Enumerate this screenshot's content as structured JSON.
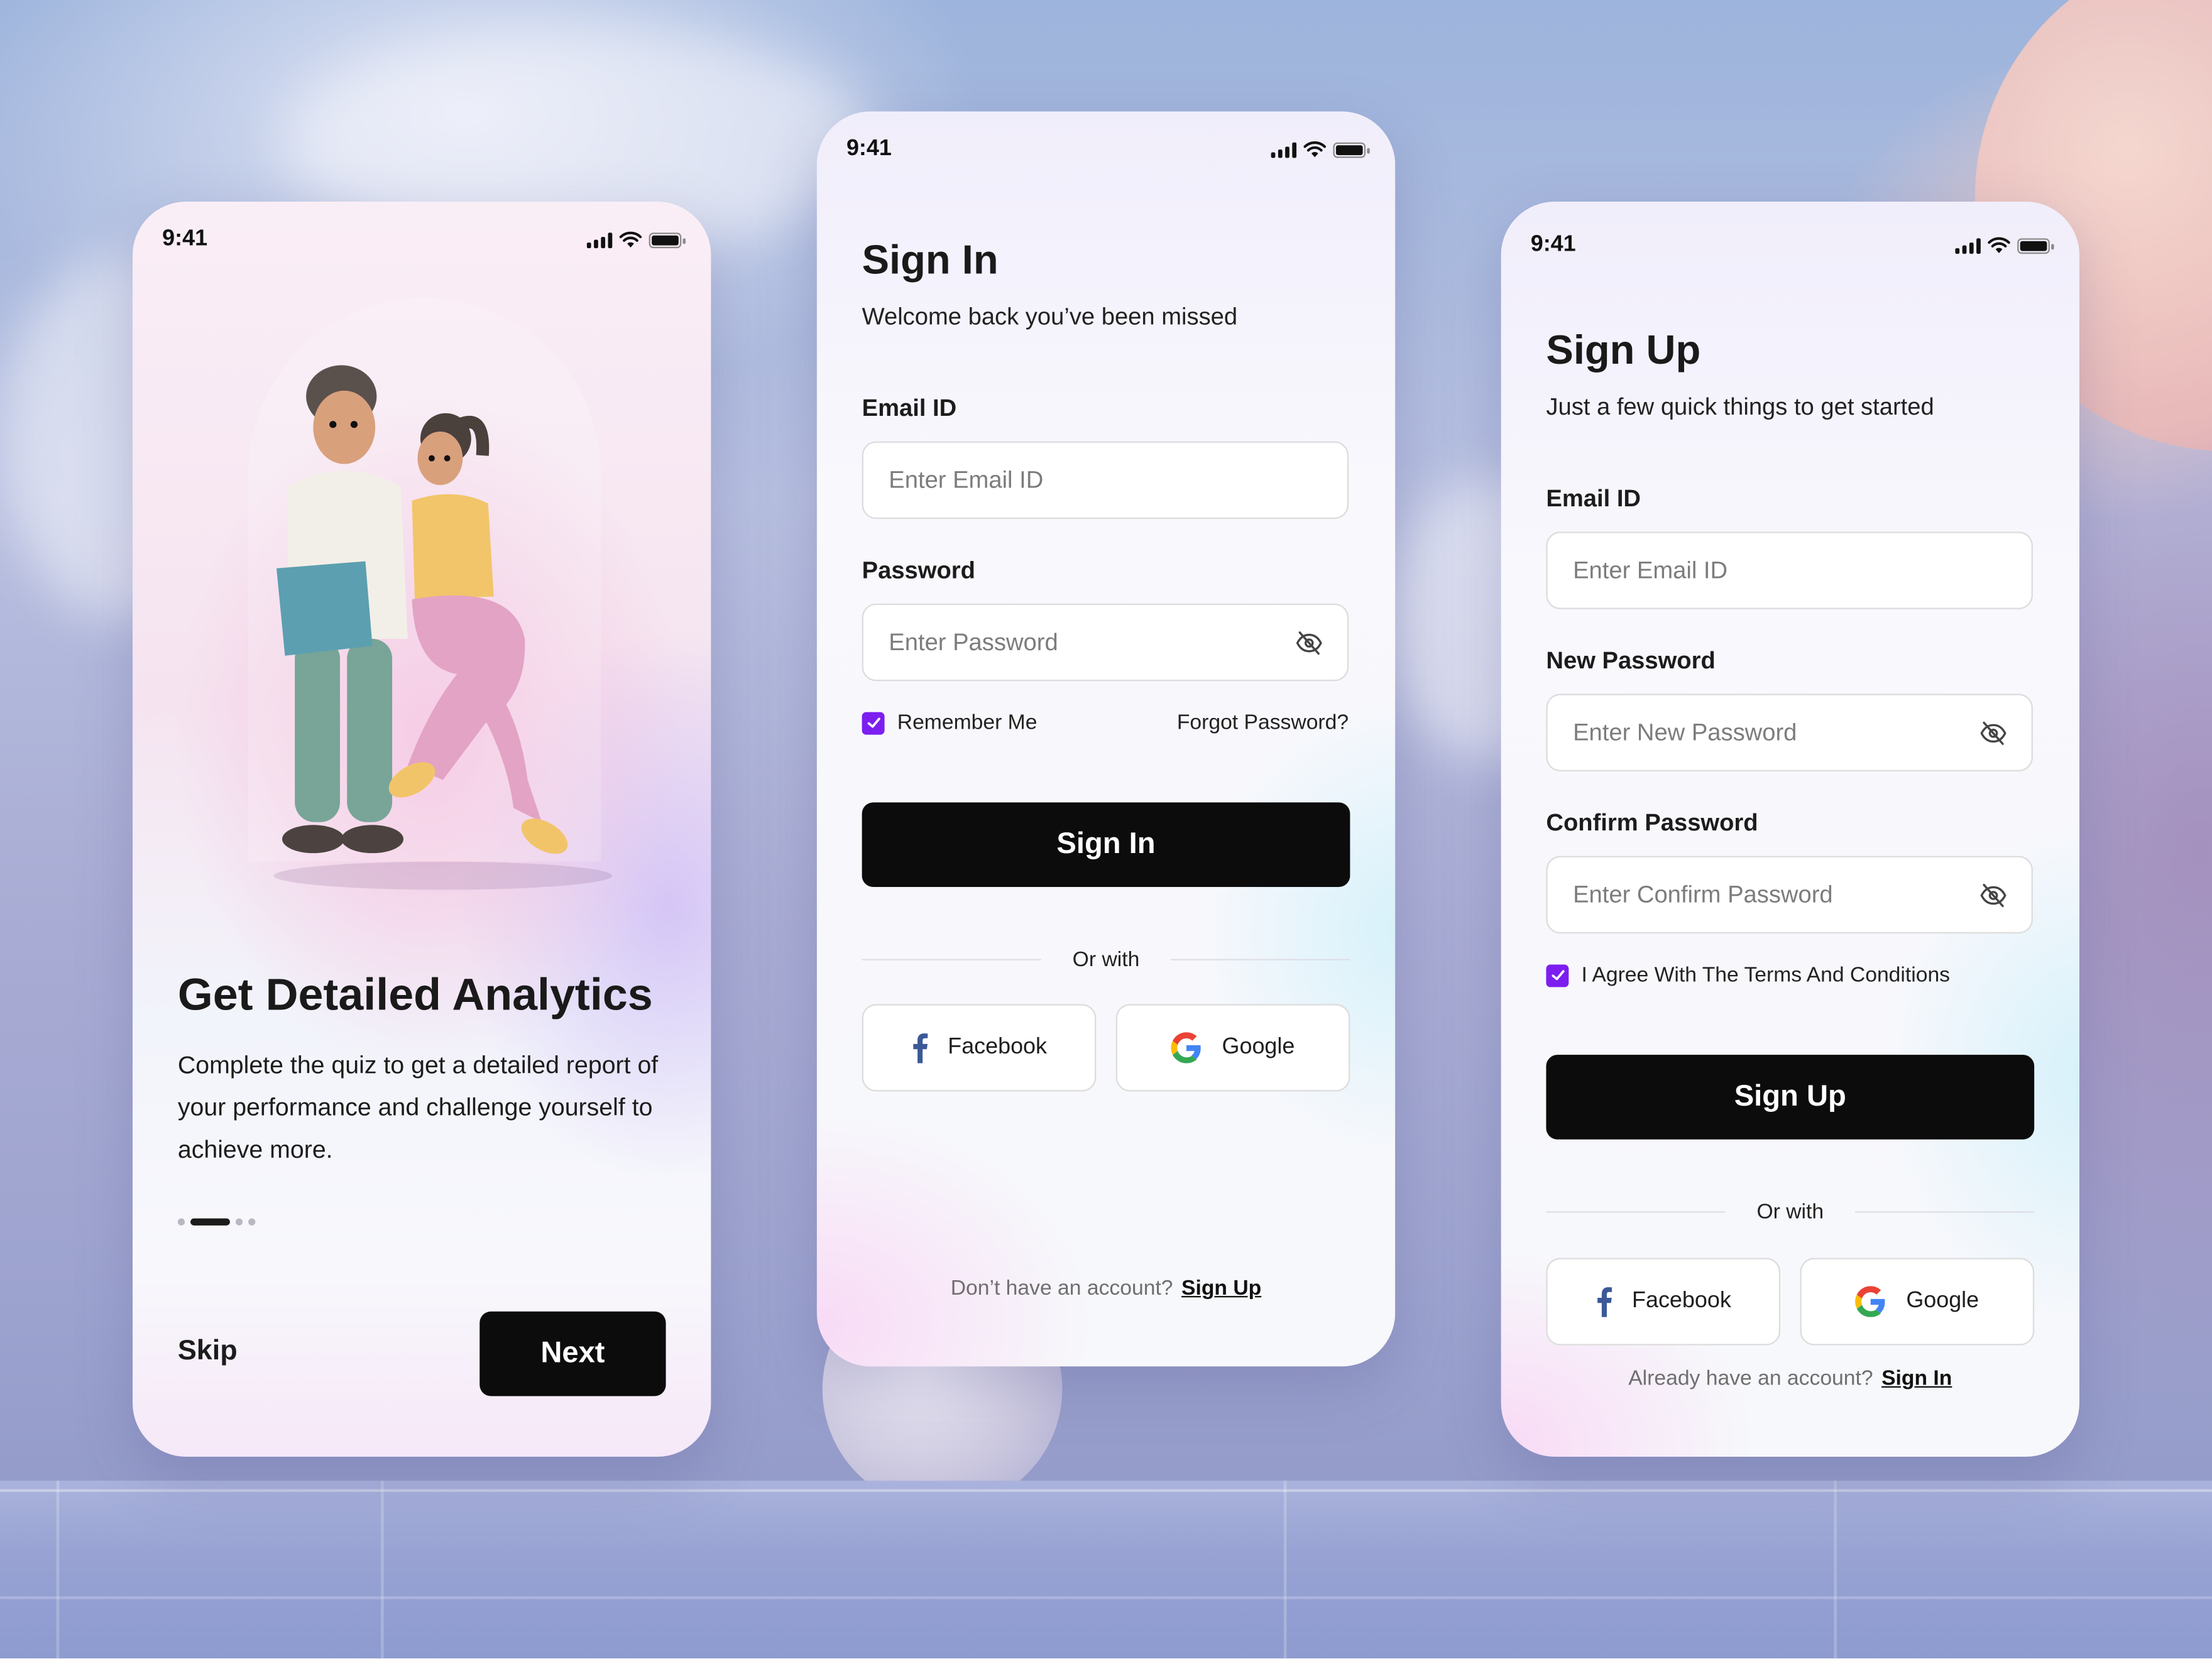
{
  "status_bar": {
    "time": "9:41"
  },
  "onboarding": {
    "title": "Get Detailed Analytics",
    "body": "Complete the quiz to get a detailed report of your performance and challenge yourself to achieve more.",
    "pagination": {
      "total": 4,
      "active_index": 1
    },
    "skip_label": "Skip",
    "next_label": "Next",
    "illustration": "two-people-with-laptop"
  },
  "sign_in": {
    "title": "Sign In",
    "subtitle": "Welcome back you’ve been missed",
    "email": {
      "label": "Email ID",
      "placeholder": "Enter Email ID",
      "value": ""
    },
    "password": {
      "label": "Password",
      "placeholder": "Enter Password",
      "value": "",
      "visibility_icon": "eye-off-icon"
    },
    "remember_me": {
      "label": "Remember Me",
      "checked": true
    },
    "forgot_password_label": "Forgot Password?",
    "submit_label": "Sign In",
    "divider_label": "Or with",
    "social": [
      {
        "label": "Facebook",
        "icon": "facebook-icon"
      },
      {
        "label": "Google",
        "icon": "google-icon"
      }
    ],
    "footer_text": "Don’t have an account?",
    "footer_link": "Sign Up"
  },
  "sign_up": {
    "title": "Sign Up",
    "subtitle": "Just a few quick things to get started",
    "email": {
      "label": "Email ID",
      "placeholder": "Enter Email ID",
      "value": ""
    },
    "new_password": {
      "label": "New Password",
      "placeholder": "Enter New Password",
      "value": "",
      "visibility_icon": "eye-off-icon"
    },
    "confirm_password": {
      "label": "Confirm Password",
      "placeholder": "Enter Confirm Password",
      "value": "",
      "visibility_icon": "eye-off-icon"
    },
    "terms": {
      "label": "I Agree With The Terms And Conditions",
      "checked": true
    },
    "submit_label": "Sign Up",
    "divider_label": "Or with",
    "social": [
      {
        "label": "Facebook",
        "icon": "facebook-icon"
      },
      {
        "label": "Google",
        "icon": "google-icon"
      }
    ],
    "footer_text": "Already have an account?",
    "footer_link": "Sign In"
  },
  "colors": {
    "primary_button": "#0c0c0c",
    "checkbox_accent": "#7c1ef0",
    "facebook_blue": "#3b5998",
    "text_dark": "#1a1a1a",
    "placeholder": "#7c7c7c"
  }
}
